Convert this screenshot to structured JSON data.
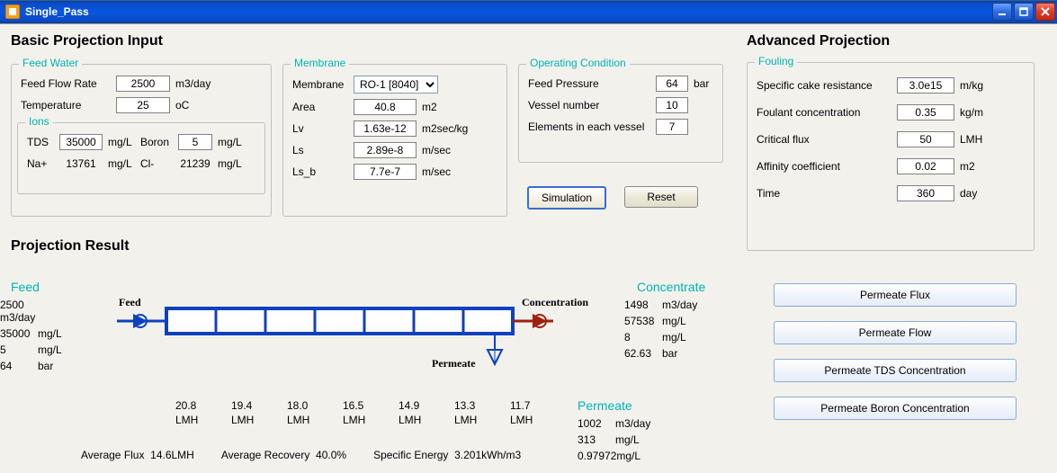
{
  "window": {
    "title": "Single_Pass"
  },
  "headings": {
    "basic_input": "Basic Projection Input",
    "projection_result": "Projection Result",
    "advanced": "Advanced Projection"
  },
  "legends": {
    "feed_water": "Feed Water",
    "ions": "Ions",
    "membrane": "Membrane",
    "operating": "Operating Condition",
    "fouling": "Fouling"
  },
  "feed_water": {
    "flow_label": "Feed Flow Rate",
    "flow_value": "2500",
    "flow_unit": "m3/day",
    "temp_label": "Temperature",
    "temp_value": "25",
    "temp_unit": "oC"
  },
  "ions": {
    "tds_label": "TDS",
    "tds_value": "35000",
    "tds_unit": "mg/L",
    "boron_label": "Boron",
    "boron_value": "5",
    "boron_unit": "mg/L",
    "na_label": "Na+",
    "na_value": "13761",
    "na_unit": "mg/L",
    "cl_label": "Cl-",
    "cl_value": "21239",
    "cl_unit": "mg/L"
  },
  "membrane": {
    "mem_label": "Membrane",
    "mem_value": "RO-1 [8040]",
    "area_label": "Area",
    "area_value": "40.8",
    "area_unit": "m2",
    "lv_label": "Lv",
    "lv_value": "1.63e-12",
    "lv_unit": "m2sec/kg",
    "ls_label": "Ls",
    "ls_value": "2.89e-8",
    "ls_unit": "m/sec",
    "lsb_label": "Ls_b",
    "lsb_value": "7.7e-7",
    "lsb_unit": "m/sec"
  },
  "operating": {
    "press_label": "Feed Pressure",
    "press_value": "64",
    "press_unit": "bar",
    "vessel_label": "Vessel number",
    "vessel_value": "10",
    "elem_label": "Elements in each vessel",
    "elem_value": "7"
  },
  "buttons": {
    "simulation": "Simulation",
    "reset": "Reset",
    "permeate_flux": "Permeate Flux",
    "permeate_flow": "Permeate Flow",
    "permeate_tds": "Permeate TDS Concentration",
    "permeate_boron": "Permeate Boron Concentration"
  },
  "fouling": {
    "cake_label": "Specific cake resistance",
    "cake_value": "3.0e15",
    "cake_unit": "m/kg",
    "foul_label": "Foulant concentration",
    "foul_value": "0.35",
    "foul_unit": "kg/m",
    "crit_label": "Critical flux",
    "crit_value": "50",
    "crit_unit": "LMH",
    "aff_label": "Affinity coefficient",
    "aff_value": "0.02",
    "aff_unit": "m2",
    "time_label": "Time",
    "time_value": "360",
    "time_unit": "day"
  },
  "result": {
    "feed_heading": "Feed",
    "feed": {
      "flow": "2500",
      "flow_u": "m3/day",
      "tds": "35000",
      "tds_u": "mg/L",
      "boron": "5",
      "boron_u": "mg/L",
      "press": "64",
      "press_u": "bar"
    },
    "conc_heading": "Concentrate",
    "conc": {
      "flow": "1498",
      "flow_u": "m3/day",
      "tds": "57538",
      "tds_u": "mg/L",
      "boron": "8",
      "boron_u": "mg/L",
      "press": "62.63",
      "press_u": "bar"
    },
    "perm_heading": "Permeate",
    "perm": {
      "flow": "1002",
      "flow_u": "m3/day",
      "tds": "313",
      "tds_u": "mg/L",
      "boron": "0.97972",
      "boron_u": "mg/L"
    },
    "diagram": {
      "feed": "Feed",
      "concentration": "Concentration",
      "permeate": "Permeate"
    },
    "lmh": [
      "20.8",
      "19.4",
      "18.0",
      "16.5",
      "14.9",
      "13.3",
      "11.7"
    ],
    "lmh_unit": "LMH",
    "avg_flux_label": "Average Flux",
    "avg_flux_value": "14.6LMH",
    "avg_rec_label": "Average Recovery",
    "avg_rec_value": "40.0%",
    "se_label": "Specific Energy",
    "se_value": "3.201kWh/m3"
  }
}
